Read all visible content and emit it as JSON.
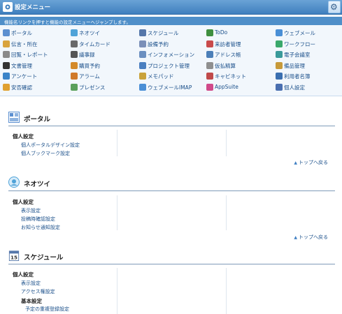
{
  "window": {
    "title": "設定メニュー",
    "settings_icon": "gear-icon"
  },
  "instruction": "機能名リンクを押すと機能の設定メニューへジャンプします。",
  "menu": [
    [
      {
        "label": "ポータル",
        "icon": "portal-icon",
        "color": "#5b8fd0"
      },
      {
        "label": "ネオツイ",
        "icon": "neotwi-icon",
        "color": "#4fa3d8"
      },
      {
        "label": "スケジュール",
        "icon": "schedule-icon",
        "color": "#5577aa"
      },
      {
        "label": "ToDo",
        "icon": "todo-icon",
        "color": "#3f8f3f"
      },
      {
        "label": "ウェブメール",
        "icon": "webmail-icon",
        "color": "#4a8fd6"
      }
    ],
    [
      {
        "label": "伝言・所在",
        "icon": "message-icon",
        "color": "#d9a33c"
      },
      {
        "label": "タイムカード",
        "icon": "timecard-icon",
        "color": "#6a6a6a"
      },
      {
        "label": "設備予約",
        "icon": "facility-icon",
        "color": "#7a8fb8"
      },
      {
        "label": "来訪者管理",
        "icon": "visitor-icon",
        "color": "#c94b4b"
      },
      {
        "label": "ワークフロー",
        "icon": "workflow-icon",
        "color": "#3aa86b"
      }
    ],
    [
      {
        "label": "回覧・レポート",
        "icon": "circular-icon",
        "color": "#8a8a8a"
      },
      {
        "label": "議事録",
        "icon": "minutes-icon",
        "color": "#555"
      },
      {
        "label": "インフォメーション",
        "icon": "info-icon",
        "color": "#6b8fc0"
      },
      {
        "label": "アドレス帳",
        "icon": "addressbook-icon",
        "color": "#4c7fb8"
      },
      {
        "label": "電子会議室",
        "icon": "conference-icon",
        "color": "#3a9a9a"
      }
    ],
    [
      {
        "label": "文書管理",
        "icon": "document-icon",
        "color": "#333"
      },
      {
        "label": "購買予約",
        "icon": "purchase-icon",
        "color": "#d48a2a"
      },
      {
        "label": "プロジェクト管理",
        "icon": "project-icon",
        "color": "#4a7fc0"
      },
      {
        "label": "仮払精算",
        "icon": "expense-icon",
        "color": "#8f8f8f"
      },
      {
        "label": "備品管理",
        "icon": "equipment-icon",
        "color": "#c79a3a"
      }
    ],
    [
      {
        "label": "アンケート",
        "icon": "survey-icon",
        "color": "#3a84c9"
      },
      {
        "label": "アラーム",
        "icon": "alarm-icon",
        "color": "#d07a2a"
      },
      {
        "label": "メモパッド",
        "icon": "memopad-icon",
        "color": "#c9a23a"
      },
      {
        "label": "キャビネット",
        "icon": "cabinet-icon",
        "color": "#c04a4a"
      },
      {
        "label": "利用者名簿",
        "icon": "userlist-icon",
        "color": "#3a6fb0"
      }
    ],
    [
      {
        "label": "安否確認",
        "icon": "safety-icon",
        "color": "#e0a030"
      },
      {
        "label": "プレゼンス",
        "icon": "presence-icon",
        "color": "#5aa05a"
      },
      {
        "label": "ウェブメールIMAP",
        "icon": "imap-icon",
        "color": "#4a8fd6"
      },
      {
        "label": "AppSuite",
        "icon": "appsuite-icon",
        "color": "#d04a8a"
      },
      {
        "label": "個人設定",
        "icon": "personal-icon",
        "color": "#4a6fb0"
      }
    ]
  ],
  "sections": {
    "portal": {
      "title": "ポータル",
      "group": "個人設定",
      "links": [
        "個人ポータルデザイン設定",
        "個人ブックマーク設定"
      ],
      "to_top": "トップへ戻る"
    },
    "neotwi": {
      "title": "ネオツイ",
      "group": "個人設定",
      "links": [
        "表示設定",
        "投稿時確認設定",
        "お知らせ通知設定"
      ],
      "to_top": "トップへ戻る"
    },
    "schedule": {
      "title": "スケジュール",
      "day_number": "15",
      "group": "個人設定",
      "links": [
        "表示設定",
        "アクセス権設定"
      ],
      "group2": "基本設定",
      "links2": [
        "予定の重複登録設定"
      ]
    }
  }
}
